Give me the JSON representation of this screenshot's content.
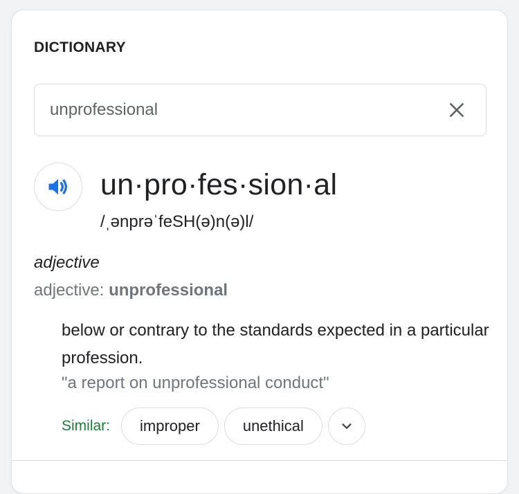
{
  "section": {
    "title": "DICTIONARY"
  },
  "search": {
    "value": "unprofessional"
  },
  "icons": {
    "clear": "close-icon",
    "speaker": "speaker-icon",
    "expand": "chevron-down-icon"
  },
  "entry": {
    "headword": "un·pro·fes·sion·al",
    "phonetic": "/ˌənprəˈfeSH(ə)n(ə)l/",
    "part_of_speech": "adjective",
    "pos_label": "adjective: ",
    "pos_word": "unprofessional",
    "definition": "below or contrary to the standards expected in a particular profession.",
    "example": "\"a report on unprofessional conduct\"",
    "similar_label": "Similar:",
    "similar": [
      "improper",
      "unethical"
    ]
  },
  "colors": {
    "accent": "#1a73e8",
    "similar_label": "#188038",
    "muted_text": "#70757a"
  }
}
